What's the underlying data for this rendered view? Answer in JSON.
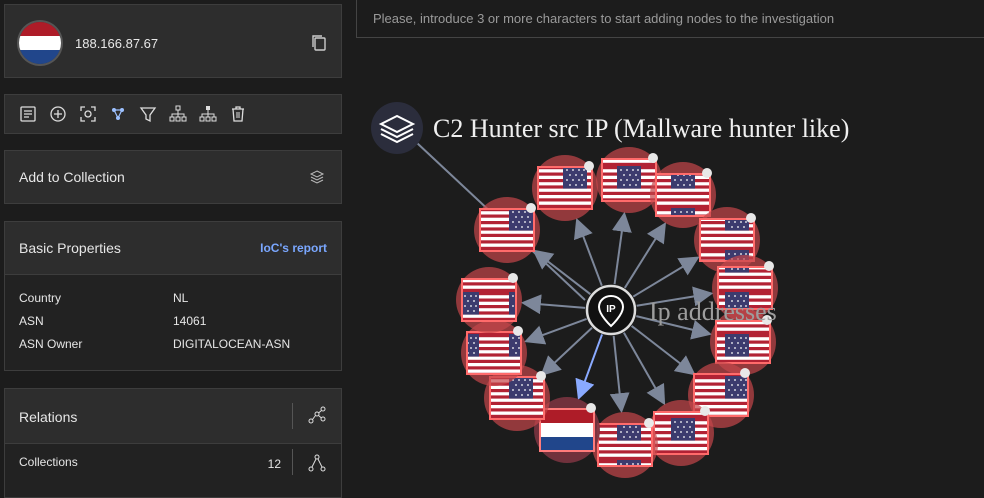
{
  "header": {
    "ip": "188.166.87.67",
    "flag": "nl-flag"
  },
  "toolbar": {
    "icons": [
      "notes-icon",
      "add-icon",
      "screenshot-icon",
      "graph-icon",
      "filter-icon",
      "hierarchy-icon",
      "hierarchy-down-icon",
      "trash-icon"
    ]
  },
  "collection": {
    "label": "Add to Collection"
  },
  "basic": {
    "title": "Basic Properties",
    "report_link": "IoC's report",
    "rows": [
      {
        "key": "Country",
        "value": "NL"
      },
      {
        "key": "ASN",
        "value": "14061"
      },
      {
        "key": "ASN Owner",
        "value": "DIGITALOCEAN-ASN"
      }
    ]
  },
  "relations": {
    "title": "Relations",
    "rows": [
      {
        "label": "Collections",
        "count": "12"
      }
    ]
  },
  "search": {
    "placeholder": "Please, introduce 3 or more characters to start adding nodes to the investigation"
  },
  "graph": {
    "collection_node_label": "C2 Hunter src IP (Mallware hunter like)",
    "ip_node_label": "Ip addresses",
    "colors": {
      "us_node_ring": "#c5464a",
      "selected_edge": "#8aaaff",
      "edge": "#7d879a"
    },
    "nodes": [
      "us-flag",
      "us-flag",
      "us-flag",
      "us-flag",
      "us-flag",
      "us-flag",
      "us-flag",
      "us-flag",
      "us-flag",
      "us-flag",
      "nl-flag",
      "us-flag",
      "us-flag",
      "us-flag"
    ]
  }
}
